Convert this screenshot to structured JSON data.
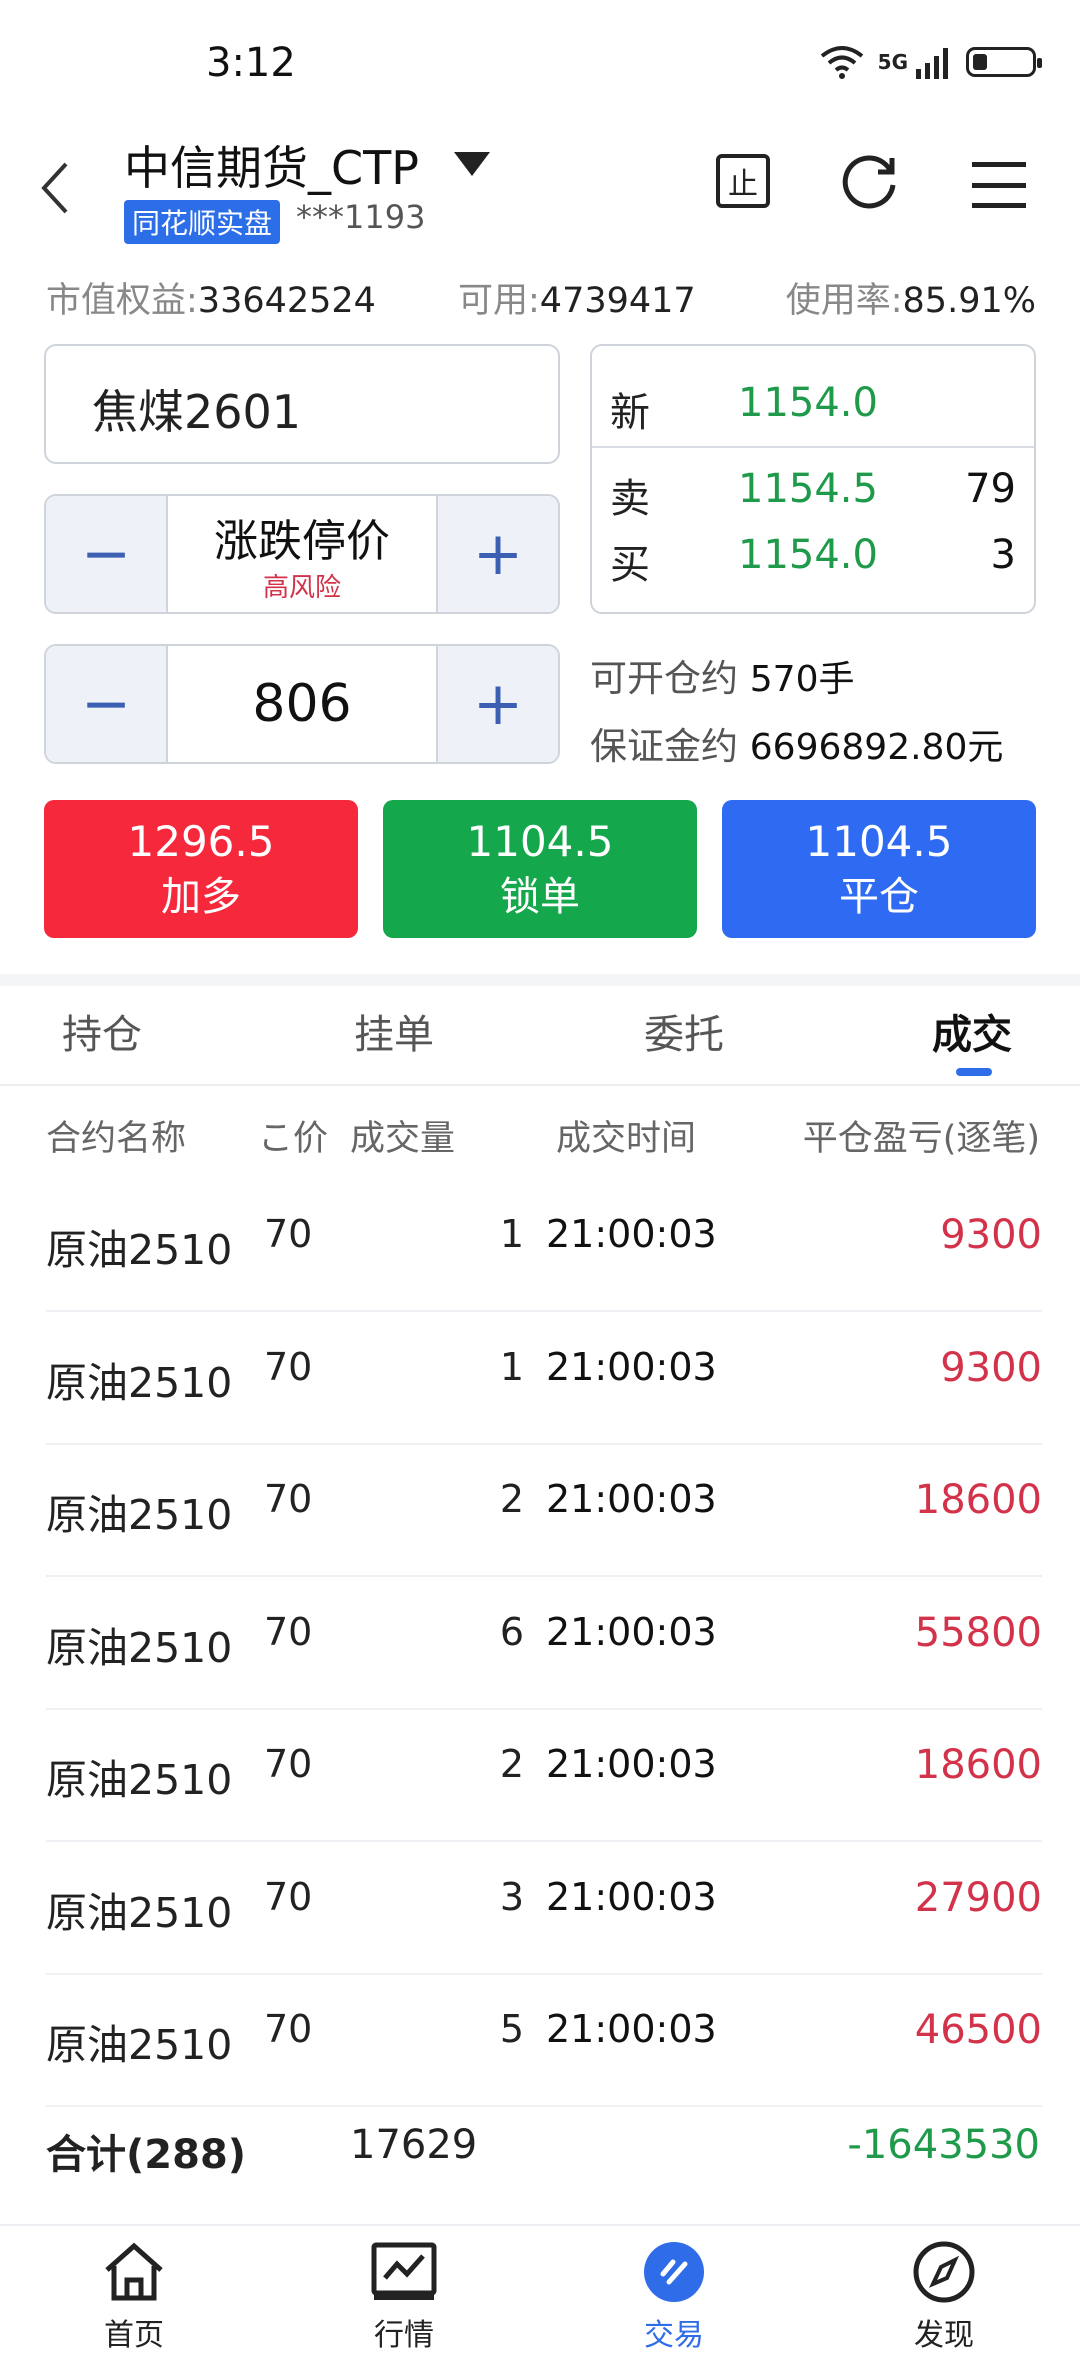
{
  "status": {
    "time": "3:12",
    "network": "5G"
  },
  "header": {
    "account_title": "中信期货_CTP",
    "badge": "同花顺实盘",
    "account_no": "***1193",
    "stop_btn": "止"
  },
  "summary": {
    "equity_label": "市值权益:",
    "equity": "33642524",
    "avail_label": "可用:",
    "avail": "4739417",
    "usage_label": "使用率:",
    "usage": "85.91%"
  },
  "order": {
    "contract": "焦煤2601",
    "price_mode": "涨跌停价",
    "risk_note": "高风险",
    "quantity": "806",
    "minus": "−",
    "plus": "+"
  },
  "quote": {
    "new_label": "新",
    "new_price": "1154.0",
    "sell_label": "卖",
    "sell_price": "1154.5",
    "sell_vol": "79",
    "buy_label": "买",
    "buy_price": "1154.0",
    "buy_vol": "3"
  },
  "capacity": {
    "open_label": "可开仓约",
    "open_value": "570手",
    "margin_label": "保证金约",
    "margin_value": "6696892.80元"
  },
  "actions": [
    {
      "price": "1296.5",
      "label": "加多",
      "color": "#f5283c"
    },
    {
      "price": "1104.5",
      "label": "锁单",
      "color": "#14a74b"
    },
    {
      "price": "1104.5",
      "label": "平仓",
      "color": "#2f6af2"
    }
  ],
  "tabs": [
    "持仓",
    "挂单",
    "委托",
    "成交"
  ],
  "active_tab": "成交",
  "table": {
    "headers": {
      "name": "合约名称",
      "price": "こ价",
      "qty": "成交量",
      "time": "成交时间",
      "pnl": "平仓盈亏(逐笔)"
    },
    "rows": [
      {
        "name": "原油2510",
        "price": "70",
        "qty": "1",
        "time": "21:00:03",
        "pnl": "9300"
      },
      {
        "name": "原油2510",
        "price": "70",
        "qty": "1",
        "time": "21:00:03",
        "pnl": "9300"
      },
      {
        "name": "原油2510",
        "price": "70",
        "qty": "2",
        "time": "21:00:03",
        "pnl": "18600"
      },
      {
        "name": "原油2510",
        "price": "70",
        "qty": "6",
        "time": "21:00:03",
        "pnl": "55800"
      },
      {
        "name": "原油2510",
        "price": "70",
        "qty": "2",
        "time": "21:00:03",
        "pnl": "18600"
      },
      {
        "name": "原油2510",
        "price": "70",
        "qty": "3",
        "time": "21:00:03",
        "pnl": "27900"
      },
      {
        "name": "原油2510",
        "price": "70",
        "qty": "5",
        "time": "21:00:03",
        "pnl": "46500"
      }
    ],
    "total": {
      "label": "合计(288)",
      "qty": "17629",
      "pnl": "-1643530"
    }
  },
  "nav": [
    {
      "label": "首页",
      "icon": "home-icon"
    },
    {
      "label": "行情",
      "icon": "chart-icon"
    },
    {
      "label": "交易",
      "icon": "trade-icon"
    },
    {
      "label": "发现",
      "icon": "compass-icon"
    }
  ]
}
